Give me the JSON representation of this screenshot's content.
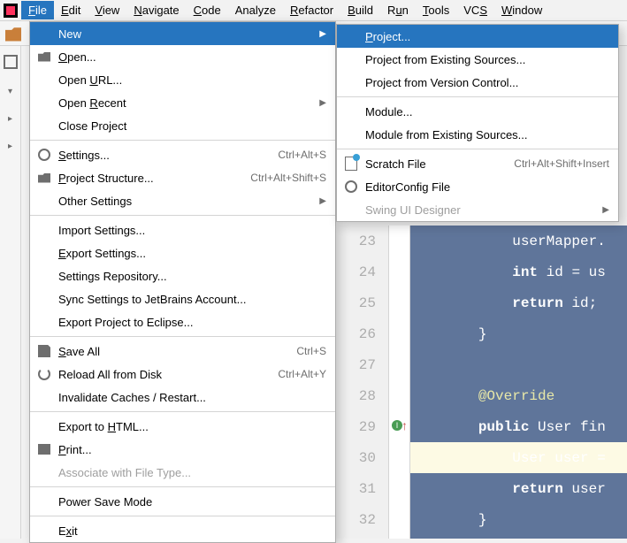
{
  "menubar": {
    "items": [
      {
        "label": "File",
        "u": "F",
        "active": true
      },
      {
        "label": "Edit",
        "u": "E"
      },
      {
        "label": "View",
        "u": "V"
      },
      {
        "label": "Navigate",
        "u": "N"
      },
      {
        "label": "Code",
        "u": "C"
      },
      {
        "label": "Analyze"
      },
      {
        "label": "Refactor",
        "u": "R"
      },
      {
        "label": "Build",
        "u": "B"
      },
      {
        "label": "Run",
        "u": "u",
        "pre": "R"
      },
      {
        "label": "Tools",
        "u": "T"
      },
      {
        "label": "VCS",
        "u": "S",
        "pre": "VC"
      },
      {
        "label": "Window",
        "u": "W"
      }
    ]
  },
  "file_menu": {
    "groups": [
      [
        {
          "label": "New",
          "selected": true,
          "arrow": true,
          "name": "file-new"
        },
        {
          "label": "Open...",
          "u": "O",
          "icon": "folder",
          "name": "file-open"
        },
        {
          "label": "Open URL...",
          "u": "U",
          "pre": "Open ",
          "name": "file-open-url"
        },
        {
          "label": "Open Recent",
          "u": "R",
          "pre": "Open ",
          "arrow": true,
          "name": "file-open-recent"
        },
        {
          "label": "Close Project",
          "u": "j",
          "pre": "Close Pro",
          "post": "ect",
          "name": "file-close-project"
        }
      ],
      [
        {
          "label": "Settings...",
          "u": "S",
          "icon": "gear",
          "shortcut": "Ctrl+Alt+S",
          "name": "file-settings"
        },
        {
          "label": "Project Structure...",
          "u": "P",
          "icon": "struct",
          "shortcut": "Ctrl+Alt+Shift+S",
          "name": "file-project-structure"
        },
        {
          "label": "Other Settings",
          "arrow": true,
          "name": "file-other-settings"
        }
      ],
      [
        {
          "label": "Import Settings...",
          "name": "file-import-settings"
        },
        {
          "label": "Export Settings...",
          "u": "E",
          "name": "file-export-settings"
        },
        {
          "label": "Settings Repository...",
          "name": "file-settings-repo"
        },
        {
          "label": "Sync Settings to JetBrains Account...",
          "name": "file-sync-settings"
        },
        {
          "label": "Export Project to Eclipse...",
          "name": "file-export-eclipse"
        }
      ],
      [
        {
          "label": "Save All",
          "u": "S",
          "icon": "disk",
          "shortcut": "Ctrl+S",
          "name": "file-save-all"
        },
        {
          "label": "Reload All from Disk",
          "icon": "reload",
          "shortcut": "Ctrl+Alt+Y",
          "name": "file-reload"
        },
        {
          "label": "Invalidate Caches / Restart...",
          "name": "file-invalidate"
        }
      ],
      [
        {
          "label": "Export to HTML...",
          "u": "H",
          "pre": "Export to ",
          "post": "TML...",
          "name": "file-export-html"
        },
        {
          "label": "Print...",
          "u": "P",
          "icon": "print",
          "name": "file-print"
        },
        {
          "label": "Associate with File Type...",
          "disabled": true,
          "name": "file-associate"
        }
      ],
      [
        {
          "label": "Power Save Mode",
          "name": "file-power-save"
        }
      ],
      [
        {
          "label": "Exit",
          "u": "x",
          "pre": "E",
          "name": "file-exit"
        }
      ]
    ]
  },
  "new_menu": {
    "groups": [
      [
        {
          "label": "Project...",
          "u": "P",
          "selected": true,
          "name": "new-project"
        },
        {
          "label": "Project from Existing Sources...",
          "name": "new-project-existing"
        },
        {
          "label": "Project from Version Control...",
          "name": "new-project-vcs"
        }
      ],
      [
        {
          "label": "Module...",
          "name": "new-module"
        },
        {
          "label": "Module from Existing Sources...",
          "name": "new-module-existing"
        }
      ],
      [
        {
          "label": "Scratch File",
          "icon": "scratch",
          "shortcut": "Ctrl+Alt+Shift+Insert",
          "name": "new-scratch"
        },
        {
          "label": "EditorConfig File",
          "icon": "edconf",
          "name": "new-editorconfig"
        },
        {
          "label": "Swing UI Designer",
          "disabled": true,
          "arrow": true,
          "name": "new-swing"
        }
      ]
    ]
  },
  "editor": {
    "lines": [
      {
        "n": "23",
        "code": [
          {
            "t": "            userMapper.",
            "c": "nrm"
          }
        ]
      },
      {
        "n": "24",
        "code": [
          {
            "t": "            ",
            "c": "nrm"
          },
          {
            "t": "int",
            "c": "kw"
          },
          {
            "t": " id = us",
            "c": "nrm"
          }
        ]
      },
      {
        "n": "25",
        "code": [
          {
            "t": "            ",
            "c": "nrm"
          },
          {
            "t": "return",
            "c": "kw"
          },
          {
            "t": " id;",
            "c": "nrm"
          }
        ]
      },
      {
        "n": "26",
        "code": [
          {
            "t": "        }",
            "c": "nrm"
          }
        ]
      },
      {
        "n": "27",
        "code": [
          {
            "t": "",
            "c": "nrm"
          }
        ]
      },
      {
        "n": "28",
        "code": [
          {
            "t": "        ",
            "c": "nrm"
          },
          {
            "t": "@Override",
            "c": "ann"
          }
        ]
      },
      {
        "n": "29",
        "mark": true,
        "code": [
          {
            "t": "        ",
            "c": "nrm"
          },
          {
            "t": "public",
            "c": "kw"
          },
          {
            "t": " User fin",
            "c": "nrm"
          }
        ]
      },
      {
        "n": "30",
        "empty": true,
        "code": [
          {
            "t": "            User user =",
            "c": "nrm"
          }
        ]
      },
      {
        "n": "31",
        "code": [
          {
            "t": "            ",
            "c": "nrm"
          },
          {
            "t": "return",
            "c": "kw"
          },
          {
            "t": " user",
            "c": "nrm"
          }
        ]
      },
      {
        "n": "32",
        "code": [
          {
            "t": "        }",
            "c": "nrm"
          }
        ]
      }
    ]
  }
}
